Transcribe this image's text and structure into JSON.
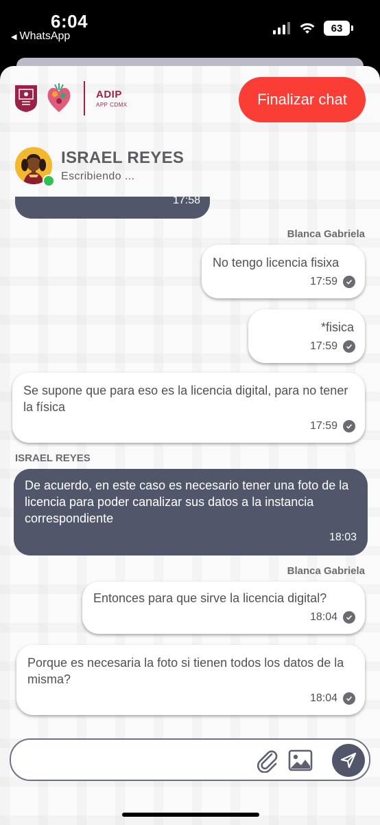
{
  "status_bar": {
    "time": "6:04",
    "back_app": "WhatsApp",
    "battery": "63"
  },
  "header": {
    "brand_title": "ADIP",
    "brand_subtitle": "APP CDMX",
    "end_chat_label": "Finalizar chat",
    "end_chat_color": "#fa3d35",
    "brand_color": "#9b2247"
  },
  "contact": {
    "name": "ISRAEL REYES",
    "status": "Escribiendo ...",
    "online_color": "#2fc152"
  },
  "messages": [
    {
      "type": "in",
      "text": "",
      "time": "17:58"
    },
    {
      "sender": "Blanca Gabriela",
      "type": "out",
      "text": "No tengo licencia fisixa",
      "time": "17:59"
    },
    {
      "type": "out",
      "text": "*fisica",
      "time": "17:59"
    },
    {
      "type": "out",
      "text": "Se supone que para eso es la licencia digital, para no tener la física",
      "time": "17:59"
    },
    {
      "sender": "ISRAEL REYES",
      "type": "in",
      "text": "De acuerdo, en este caso es necesario tener una foto de la licencia para poder canalizar sus datos a la instancia correspondiente",
      "time": "18:03"
    },
    {
      "sender": "Blanca Gabriela",
      "type": "out",
      "text": "Entonces para que sirve la licencia digital?",
      "time": "18:04"
    },
    {
      "type": "out",
      "text": "Porque es necesaria la foto si tienen todos los datos de la misma?",
      "time": "18:04"
    }
  ],
  "input": {
    "placeholder": "",
    "icons": [
      "paperclip-icon",
      "image-icon",
      "send-icon"
    ]
  }
}
